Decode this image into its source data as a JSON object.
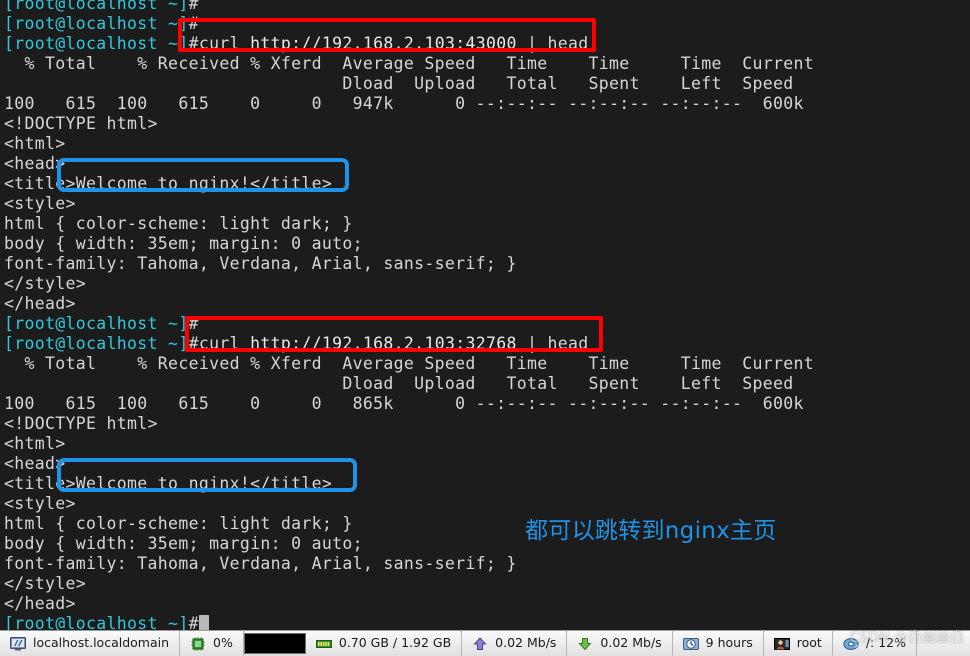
{
  "terminal": {
    "prompt": "[root@localhost ~]",
    "hash": "#",
    "lines": [
      {
        "type": "prompt-clipped",
        "text": "[root@localhost ~]#"
      },
      {
        "type": "prompt",
        "text": "[root@localhost ~]#"
      },
      {
        "type": "command",
        "cmd": "curl ",
        "url": "http://192.168.2.103:43000",
        "tail": " | head"
      },
      {
        "type": "out",
        "text": "  % Total    % Received % Xferd  Average Speed   Time    Time     Time  Current"
      },
      {
        "type": "out",
        "text": "                                 Dload  Upload   Total   Spent    Left  Speed"
      },
      {
        "type": "out",
        "text": "100   615  100   615    0     0   947k      0 --:--:-- --:--:-- --:--:--  600k"
      },
      {
        "type": "out",
        "text": "<!DOCTYPE html>"
      },
      {
        "type": "out",
        "text": "<html>"
      },
      {
        "type": "out",
        "text": "<head>"
      },
      {
        "type": "out",
        "text": "<title>Welcome to nginx!</title>"
      },
      {
        "type": "out",
        "text": "<style>"
      },
      {
        "type": "out",
        "text": "html { color-scheme: light dark; }"
      },
      {
        "type": "out",
        "text": "body { width: 35em; margin: 0 auto;"
      },
      {
        "type": "out",
        "text": "font-family: Tahoma, Verdana, Arial, sans-serif; }"
      },
      {
        "type": "out",
        "text": "</style>"
      },
      {
        "type": "out",
        "text": "</head>"
      },
      {
        "type": "prompt",
        "text": "[root@localhost ~]#"
      },
      {
        "type": "command",
        "cmd": "curl ",
        "url": "http://192.168.2.103:32768",
        "tail": " | head"
      },
      {
        "type": "out",
        "text": "  % Total    % Received % Xferd  Average Speed   Time    Time     Time  Current"
      },
      {
        "type": "out",
        "text": "                                 Dload  Upload   Total   Spent    Left  Speed"
      },
      {
        "type": "out",
        "text": "100   615  100   615    0     0   865k      0 --:--:-- --:--:-- --:--:--  600k"
      },
      {
        "type": "out",
        "text": "<!DOCTYPE html>"
      },
      {
        "type": "out",
        "text": "<html>"
      },
      {
        "type": "out",
        "text": "<head>"
      },
      {
        "type": "out",
        "text": "<title>Welcome to nginx!</title>"
      },
      {
        "type": "out",
        "text": "<style>"
      },
      {
        "type": "out",
        "text": "html { color-scheme: light dark; }"
      },
      {
        "type": "out",
        "text": "body { width: 35em; margin: 0 auto;"
      },
      {
        "type": "out",
        "text": "font-family: Tahoma, Verdana, Arial, sans-serif; }"
      },
      {
        "type": "out",
        "text": "</style>"
      },
      {
        "type": "out",
        "text": "</head>"
      },
      {
        "type": "prompt-cursor",
        "text": "[root@localhost ~]#"
      }
    ]
  },
  "annotations": {
    "note_cn": "都可以跳转到nginx主页",
    "red_color": "#fe0000",
    "blue_color": "#1e93e8"
  },
  "statusbar": {
    "host": "localhost.localdomain",
    "cpu": "0%",
    "memory": "0.70 GB / 1.92 GB",
    "upload": "0.02 Mb/s",
    "download": "0.02 Mb/s",
    "uptime": "9 hours",
    "user": "root",
    "disk": "/: 12%"
  },
  "watermark": {
    "text": "CSDN @白幽幽白"
  }
}
